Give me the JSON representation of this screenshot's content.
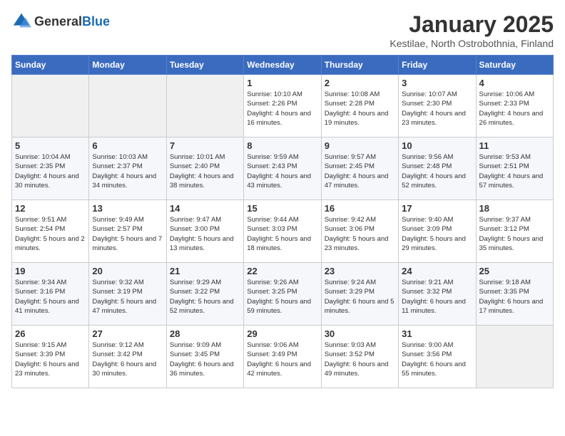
{
  "header": {
    "logo_general": "General",
    "logo_blue": "Blue",
    "title": "January 2025",
    "subtitle": "Kestilae, North Ostrobothnia, Finland"
  },
  "days_of_week": [
    "Sunday",
    "Monday",
    "Tuesday",
    "Wednesday",
    "Thursday",
    "Friday",
    "Saturday"
  ],
  "weeks": [
    [
      {
        "day": "",
        "sunrise": "",
        "sunset": "",
        "daylight": ""
      },
      {
        "day": "",
        "sunrise": "",
        "sunset": "",
        "daylight": ""
      },
      {
        "day": "",
        "sunrise": "",
        "sunset": "",
        "daylight": ""
      },
      {
        "day": "1",
        "sunrise": "Sunrise: 10:10 AM",
        "sunset": "Sunset: 2:26 PM",
        "daylight": "Daylight: 4 hours and 16 minutes."
      },
      {
        "day": "2",
        "sunrise": "Sunrise: 10:08 AM",
        "sunset": "Sunset: 2:28 PM",
        "daylight": "Daylight: 4 hours and 19 minutes."
      },
      {
        "day": "3",
        "sunrise": "Sunrise: 10:07 AM",
        "sunset": "Sunset: 2:30 PM",
        "daylight": "Daylight: 4 hours and 23 minutes."
      },
      {
        "day": "4",
        "sunrise": "Sunrise: 10:06 AM",
        "sunset": "Sunset: 2:33 PM",
        "daylight": "Daylight: 4 hours and 26 minutes."
      }
    ],
    [
      {
        "day": "5",
        "sunrise": "Sunrise: 10:04 AM",
        "sunset": "Sunset: 2:35 PM",
        "daylight": "Daylight: 4 hours and 30 minutes."
      },
      {
        "day": "6",
        "sunrise": "Sunrise: 10:03 AM",
        "sunset": "Sunset: 2:37 PM",
        "daylight": "Daylight: 4 hours and 34 minutes."
      },
      {
        "day": "7",
        "sunrise": "Sunrise: 10:01 AM",
        "sunset": "Sunset: 2:40 PM",
        "daylight": "Daylight: 4 hours and 38 minutes."
      },
      {
        "day": "8",
        "sunrise": "Sunrise: 9:59 AM",
        "sunset": "Sunset: 2:43 PM",
        "daylight": "Daylight: 4 hours and 43 minutes."
      },
      {
        "day": "9",
        "sunrise": "Sunrise: 9:57 AM",
        "sunset": "Sunset: 2:45 PM",
        "daylight": "Daylight: 4 hours and 47 minutes."
      },
      {
        "day": "10",
        "sunrise": "Sunrise: 9:56 AM",
        "sunset": "Sunset: 2:48 PM",
        "daylight": "Daylight: 4 hours and 52 minutes."
      },
      {
        "day": "11",
        "sunrise": "Sunrise: 9:53 AM",
        "sunset": "Sunset: 2:51 PM",
        "daylight": "Daylight: 4 hours and 57 minutes."
      }
    ],
    [
      {
        "day": "12",
        "sunrise": "Sunrise: 9:51 AM",
        "sunset": "Sunset: 2:54 PM",
        "daylight": "Daylight: 5 hours and 2 minutes."
      },
      {
        "day": "13",
        "sunrise": "Sunrise: 9:49 AM",
        "sunset": "Sunset: 2:57 PM",
        "daylight": "Daylight: 5 hours and 7 minutes."
      },
      {
        "day": "14",
        "sunrise": "Sunrise: 9:47 AM",
        "sunset": "Sunset: 3:00 PM",
        "daylight": "Daylight: 5 hours and 13 minutes."
      },
      {
        "day": "15",
        "sunrise": "Sunrise: 9:44 AM",
        "sunset": "Sunset: 3:03 PM",
        "daylight": "Daylight: 5 hours and 18 minutes."
      },
      {
        "day": "16",
        "sunrise": "Sunrise: 9:42 AM",
        "sunset": "Sunset: 3:06 PM",
        "daylight": "Daylight: 5 hours and 23 minutes."
      },
      {
        "day": "17",
        "sunrise": "Sunrise: 9:40 AM",
        "sunset": "Sunset: 3:09 PM",
        "daylight": "Daylight: 5 hours and 29 minutes."
      },
      {
        "day": "18",
        "sunrise": "Sunrise: 9:37 AM",
        "sunset": "Sunset: 3:12 PM",
        "daylight": "Daylight: 5 hours and 35 minutes."
      }
    ],
    [
      {
        "day": "19",
        "sunrise": "Sunrise: 9:34 AM",
        "sunset": "Sunset: 3:16 PM",
        "daylight": "Daylight: 5 hours and 41 minutes."
      },
      {
        "day": "20",
        "sunrise": "Sunrise: 9:32 AM",
        "sunset": "Sunset: 3:19 PM",
        "daylight": "Daylight: 5 hours and 47 minutes."
      },
      {
        "day": "21",
        "sunrise": "Sunrise: 9:29 AM",
        "sunset": "Sunset: 3:22 PM",
        "daylight": "Daylight: 5 hours and 52 minutes."
      },
      {
        "day": "22",
        "sunrise": "Sunrise: 9:26 AM",
        "sunset": "Sunset: 3:25 PM",
        "daylight": "Daylight: 5 hours and 59 minutes."
      },
      {
        "day": "23",
        "sunrise": "Sunrise: 9:24 AM",
        "sunset": "Sunset: 3:29 PM",
        "daylight": "Daylight: 6 hours and 5 minutes."
      },
      {
        "day": "24",
        "sunrise": "Sunrise: 9:21 AM",
        "sunset": "Sunset: 3:32 PM",
        "daylight": "Daylight: 6 hours and 11 minutes."
      },
      {
        "day": "25",
        "sunrise": "Sunrise: 9:18 AM",
        "sunset": "Sunset: 3:35 PM",
        "daylight": "Daylight: 6 hours and 17 minutes."
      }
    ],
    [
      {
        "day": "26",
        "sunrise": "Sunrise: 9:15 AM",
        "sunset": "Sunset: 3:39 PM",
        "daylight": "Daylight: 6 hours and 23 minutes."
      },
      {
        "day": "27",
        "sunrise": "Sunrise: 9:12 AM",
        "sunset": "Sunset: 3:42 PM",
        "daylight": "Daylight: 6 hours and 30 minutes."
      },
      {
        "day": "28",
        "sunrise": "Sunrise: 9:09 AM",
        "sunset": "Sunset: 3:45 PM",
        "daylight": "Daylight: 6 hours and 36 minutes."
      },
      {
        "day": "29",
        "sunrise": "Sunrise: 9:06 AM",
        "sunset": "Sunset: 3:49 PM",
        "daylight": "Daylight: 6 hours and 42 minutes."
      },
      {
        "day": "30",
        "sunrise": "Sunrise: 9:03 AM",
        "sunset": "Sunset: 3:52 PM",
        "daylight": "Daylight: 6 hours and 49 minutes."
      },
      {
        "day": "31",
        "sunrise": "Sunrise: 9:00 AM",
        "sunset": "Sunset: 3:56 PM",
        "daylight": "Daylight: 6 hours and 55 minutes."
      },
      {
        "day": "",
        "sunrise": "",
        "sunset": "",
        "daylight": ""
      }
    ]
  ]
}
